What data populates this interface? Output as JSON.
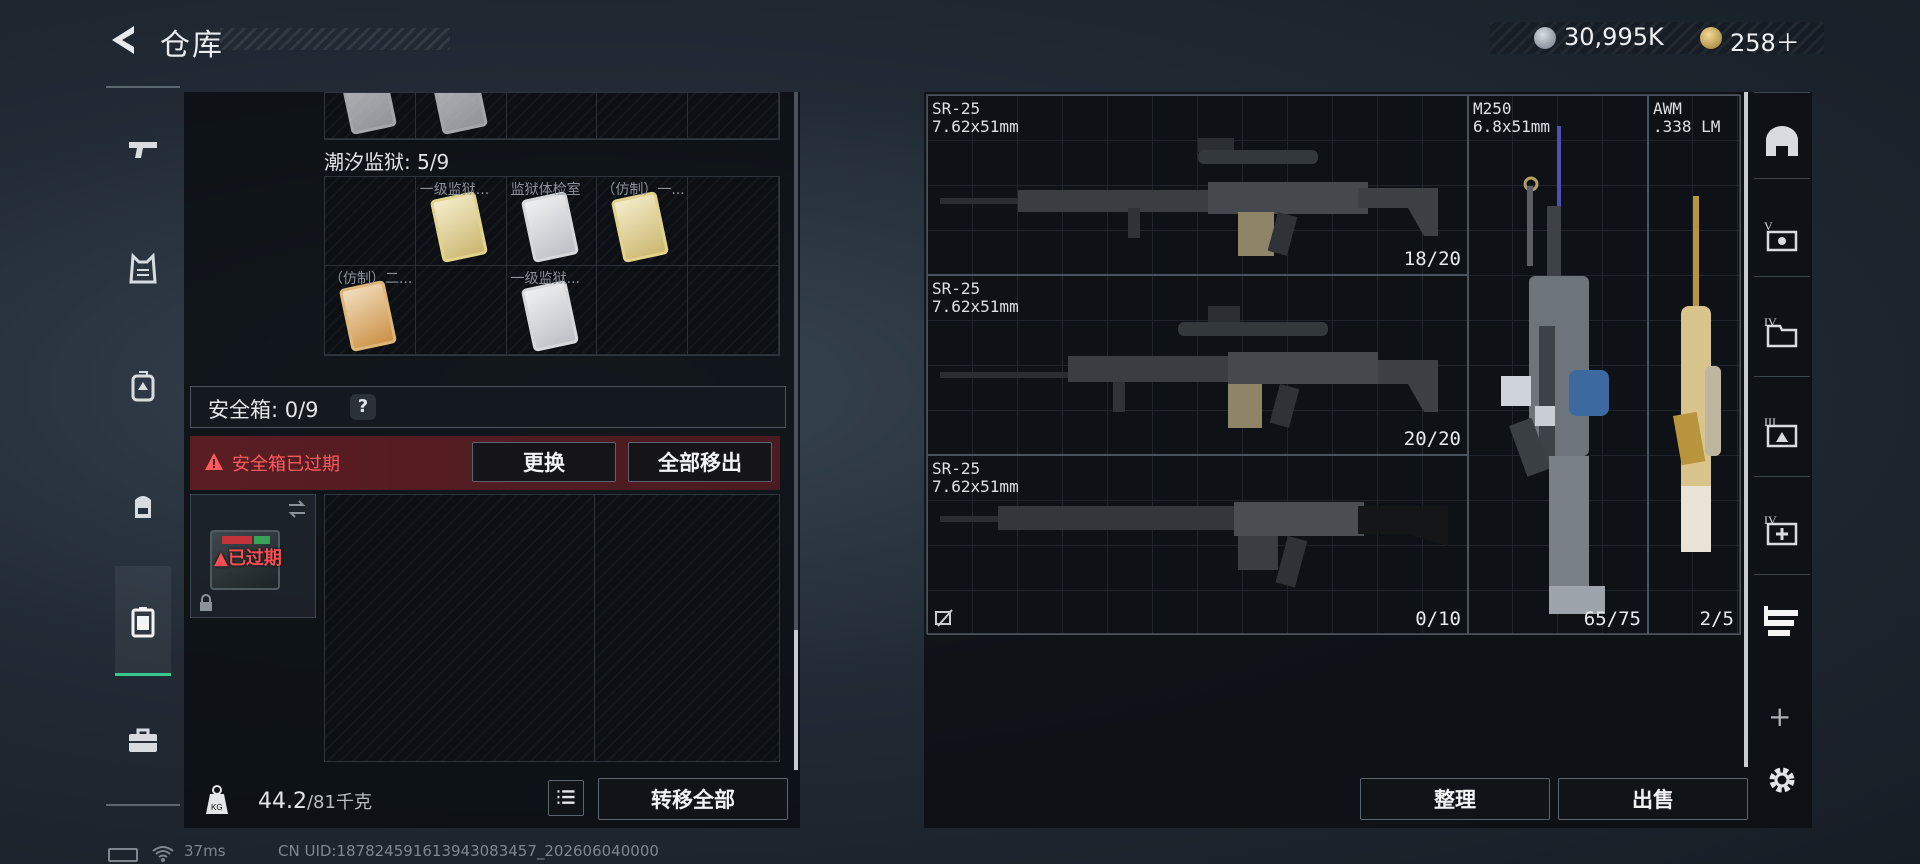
{
  "header": {
    "title": "仓库",
    "currency": [
      {
        "icon": "silver-coin-icon",
        "value": "30,995K"
      },
      {
        "icon": "gold-coin-icon",
        "value": "258＋"
      }
    ]
  },
  "left_rail": {
    "items": [
      {
        "icon": "pistol-icon"
      },
      {
        "icon": "vest-icon"
      },
      {
        "icon": "backpack-icon"
      },
      {
        "icon": "bag-icon"
      },
      {
        "icon": "safe-box-icon",
        "active": true
      },
      {
        "icon": "toolbox-icon"
      }
    ]
  },
  "prison": {
    "title": "潮汐监狱: 5/9",
    "cells": [
      {
        "label": "",
        "item": ""
      },
      {
        "label": "一级监狱...",
        "item": "yellow"
      },
      {
        "label": "监狱体检室",
        "item": "white"
      },
      {
        "label": "（仿制）一...",
        "item": "yellow"
      },
      {
        "label": "",
        "item": ""
      },
      {
        "label": "（仿制）二...",
        "item": "orange"
      },
      {
        "label": "",
        "item": ""
      },
      {
        "label": "一级监狱...",
        "item": "white"
      },
      {
        "label": "",
        "item": ""
      },
      {
        "label": "",
        "item": ""
      }
    ]
  },
  "safe": {
    "label": "安全箱: 0/9",
    "help": "?",
    "expired_warning": "安全箱已过期",
    "replace_btn": "更换",
    "moveall_btn": "全部移出",
    "expired_tag": "已过期"
  },
  "bottom_left": {
    "weight": "44.2",
    "weight_max": "/81千克",
    "transfer_btn": "转移全部"
  },
  "status": {
    "ping": "37ms",
    "uid": "CN UID:187824591613943083457_202606040000"
  },
  "weapons": [
    {
      "name": "SR-25",
      "caliber": "7.62x51mm",
      "count": "18/20"
    },
    {
      "name": "SR-25",
      "caliber": "7.62x51mm",
      "count": "20/20"
    },
    {
      "name": "SR-25",
      "caliber": "7.62x51mm",
      "count": "0/10"
    },
    {
      "name": "M250",
      "caliber": "6.8x51mm",
      "count": "65/75"
    },
    {
      "name": "AWM",
      "caliber": ".338 LM",
      "count": "2/5"
    }
  ],
  "bottom_right": {
    "sort_btn": "整理",
    "sell_btn": "出售"
  },
  "right_rail": {
    "items": [
      {
        "icon": "helmet-icon"
      },
      {
        "icon": "tier-v-icon",
        "label": "V"
      },
      {
        "icon": "tier-iv-folder-icon",
        "label": "IV"
      },
      {
        "icon": "tier-iii-icon",
        "label": "III"
      },
      {
        "icon": "tier-iv-medical-icon",
        "label": "IV"
      },
      {
        "icon": "weapon-filter-icon"
      }
    ],
    "plus": "+"
  },
  "colors": {
    "accent": "#35c98f",
    "danger": "#ff5a5f"
  }
}
